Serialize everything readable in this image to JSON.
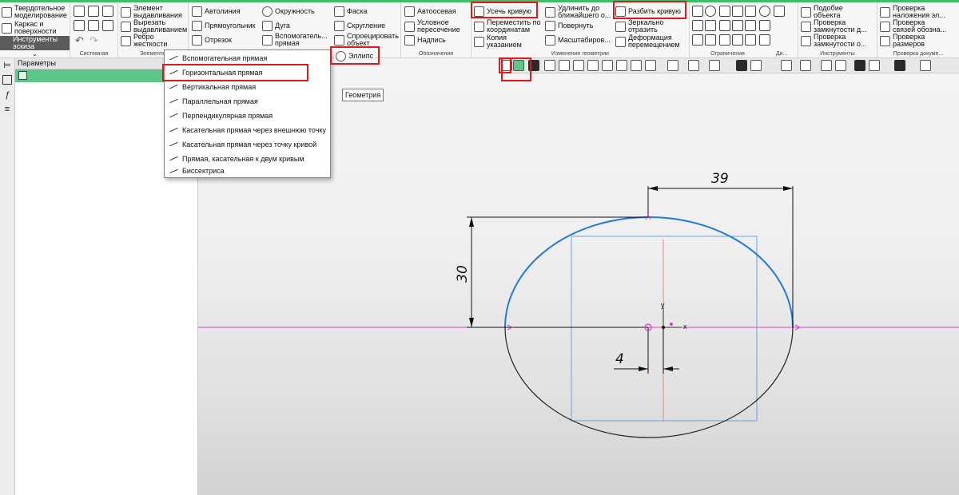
{
  "ribbon": {
    "col1": [
      "Твердотельное\nмоделирование",
      "Каркас и\nповерхности",
      "Инструменты\nэскиза"
    ],
    "elements": [
      "Элемент\nвыдавливания",
      "Вырезать\nвыдавливанием",
      "Ребро\nжесткости"
    ],
    "geometry": [
      "Автолиния",
      "Прямоугольник",
      "Отрезок",
      "Окружность",
      "Дуга",
      "Вспомогатель...\nпрямая",
      "Фаска",
      "Скругление",
      "Спроецировать\nобъект",
      "Эллипс"
    ],
    "annotations": [
      "Автоосевая",
      "Условное\nпересечение",
      "Надпись"
    ],
    "edit": [
      "Усечь кривую",
      "Переместить по\nкоординатам",
      "Копия\nуказанием",
      "Удлинить до\nближайшего о...",
      "Повернуть",
      "Масштабиров...",
      "Разбить кривую",
      "Зеркально\nотразить",
      "Деформация\nперемещением"
    ],
    "tools": [
      "Подобие\nобъекта",
      "Проверка\nзамкнутости д...",
      "Проверка\nзамкнутости о...",
      "Проверка\nналожения эл...",
      "Проверка\nсвязей обозна...",
      "Проверка\nразмеров"
    ],
    "groups": [
      "Системная",
      "Элементы",
      "Обозначения",
      "Изменение геометрии",
      "Ограничения",
      "Ди...",
      "Инструменты",
      "Проверка докуме..."
    ]
  },
  "panel": {
    "title": "Параметры"
  },
  "geometry_menu": {
    "items": [
      "Вспомогательная прямая",
      "Горизонтальная прямая",
      "Вертикальная прямая",
      "Параллельная прямая",
      "Перпендикулярная прямая",
      "Касательная прямая через внешнюю точку",
      "Касательная прямая через точку кривой",
      "Прямая, касательная к двум кривым",
      "Биссектриса"
    ]
  },
  "tooltip": "Геометрия",
  "dimensions": {
    "width": "39",
    "height": "30",
    "offset": "4"
  },
  "axes": {
    "x": "x",
    "y": "y"
  },
  "colors": {
    "ellipse_top": "#1e7be0",
    "ellipse_bottom": "#222222",
    "construction_line": "#d040d0",
    "highlight": "#e01818",
    "panel_row": "#5cc788",
    "accent": "#3fbf6a"
  }
}
